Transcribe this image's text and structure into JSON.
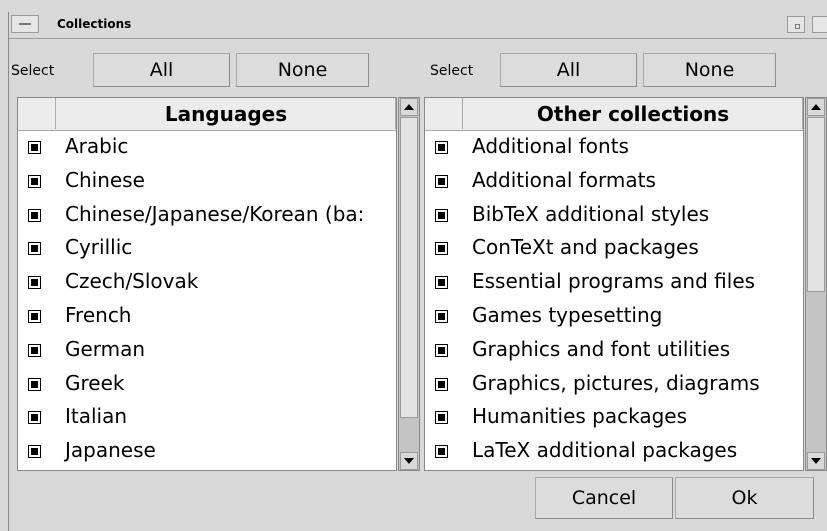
{
  "window": {
    "title": "Collections"
  },
  "left_panel": {
    "select_label": "Select",
    "all_label": "All",
    "none_label": "None",
    "header": "Languages",
    "items": [
      {
        "label": "Arabic",
        "checked": true
      },
      {
        "label": "Chinese",
        "checked": true
      },
      {
        "label": "Chinese/Japanese/Korean (ba:",
        "checked": true
      },
      {
        "label": "Cyrillic",
        "checked": true
      },
      {
        "label": "Czech/Slovak",
        "checked": true
      },
      {
        "label": "French",
        "checked": true
      },
      {
        "label": "German",
        "checked": true
      },
      {
        "label": "Greek",
        "checked": true
      },
      {
        "label": "Italian",
        "checked": true
      },
      {
        "label": "Japanese",
        "checked": true
      }
    ]
  },
  "right_panel": {
    "select_label": "Select",
    "all_label": "All",
    "none_label": "None",
    "header": "Other collections",
    "items": [
      {
        "label": "Additional fonts",
        "checked": true
      },
      {
        "label": "Additional formats",
        "checked": true
      },
      {
        "label": "BibTeX additional styles",
        "checked": true
      },
      {
        "label": "ConTeXt and packages",
        "checked": true
      },
      {
        "label": "Essential programs and files",
        "checked": true
      },
      {
        "label": "Games typesetting",
        "checked": true
      },
      {
        "label": "Graphics and font utilities",
        "checked": true
      },
      {
        "label": "Graphics, pictures, diagrams",
        "checked": true
      },
      {
        "label": "Humanities packages",
        "checked": true
      },
      {
        "label": "LaTeX additional packages",
        "checked": true
      }
    ]
  },
  "footer": {
    "cancel_label": "Cancel",
    "ok_label": "Ok"
  }
}
